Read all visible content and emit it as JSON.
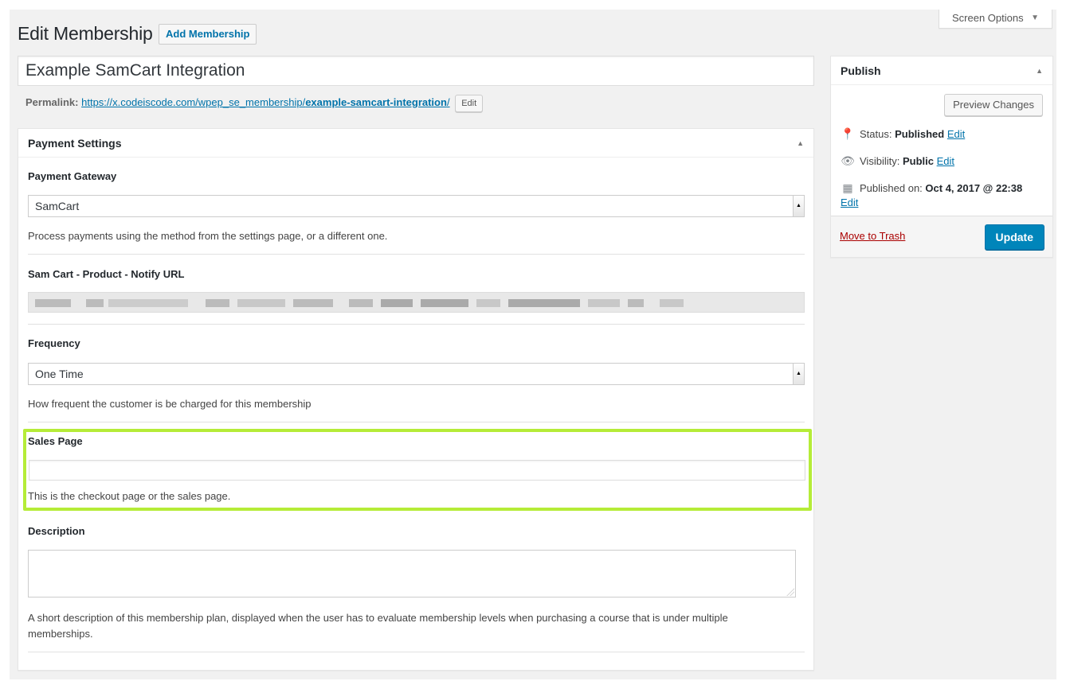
{
  "screen_options": {
    "label": "Screen Options"
  },
  "header": {
    "title": "Edit Membership",
    "add_button": "Add Membership"
  },
  "post_title": {
    "value": "Example SamCart Integration"
  },
  "permalink": {
    "label": "Permalink:",
    "url_base": "https://x.codeiscode.com/wpep_se_membership/",
    "url_slug": "example-samcart-integration",
    "url_tail": "/",
    "edit_button": "Edit"
  },
  "payment_settings": {
    "title": "Payment Settings",
    "gateway": {
      "label": "Payment Gateway",
      "selected": "SamCart",
      "description": "Process payments using the method from the settings page, or a different one."
    },
    "notify_url": {
      "label": "Sam Cart - Product - Notify URL"
    },
    "frequency": {
      "label": "Frequency",
      "selected": "One Time",
      "description": "How frequent the customer is be charged for this membership"
    },
    "sales_page": {
      "label": "Sales Page",
      "value": "",
      "description": "This is the checkout page or the sales page."
    },
    "description_field": {
      "label": "Description",
      "value": "",
      "help": "A short description of this membership plan, displayed when the user has to evaluate membership levels when purchasing a course that is under multiple memberships."
    }
  },
  "publish": {
    "title": "Publish",
    "preview_button": "Preview Changes",
    "status_label": "Status:",
    "status_value": "Published",
    "visibility_label": "Visibility:",
    "visibility_value": "Public",
    "published_label": "Published on:",
    "published_value": "Oct 4, 2017 @ 22:38",
    "edit_link": "Edit",
    "trash_link": "Move to Trash",
    "update_button": "Update"
  },
  "colors": {
    "highlight": "#b5ec38",
    "primary": "#0085ba",
    "link": "#0073aa",
    "trash": "#aa0000"
  }
}
